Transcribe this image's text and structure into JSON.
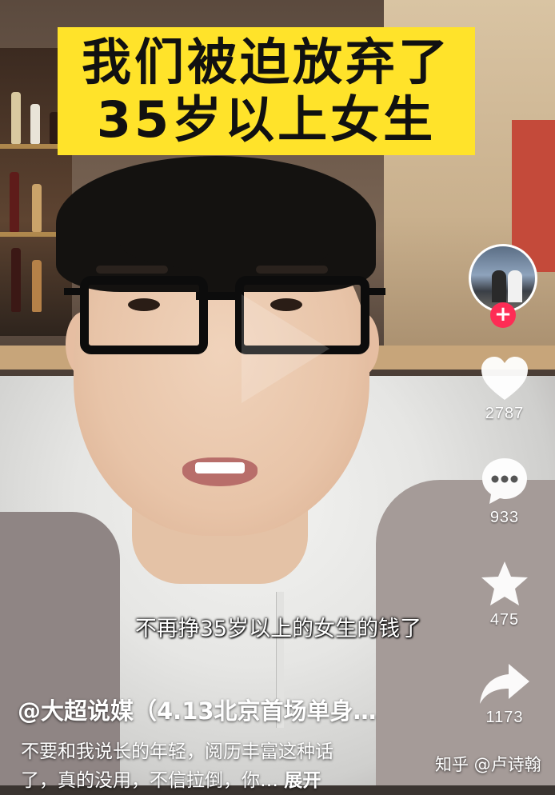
{
  "video": {
    "title_line1": "我们被迫放弃了",
    "title_line2": "35岁以上女生",
    "subtitle": "不再挣35岁以上的女生的钱了"
  },
  "actions": {
    "like_count": "2787",
    "comment_count": "933",
    "favorite_count": "475",
    "share_count": "1173",
    "follow_symbol": "+"
  },
  "post": {
    "author": "@大超说媒（4.13北京首场单身…",
    "description_line1": "不要和我说长的年轻，阅历丰富这种话",
    "description_line2": "了，真的没用，不信拉倒，你…",
    "expand_label": "展开"
  },
  "watermark": "知乎 @卢诗翰",
  "icons": [
    "heart-icon",
    "comment-icon",
    "star-icon",
    "share-icon",
    "plus-icon"
  ],
  "colors": {
    "banner": "#ffe32a",
    "follow": "#fe2c55",
    "text": "#ffffff"
  }
}
